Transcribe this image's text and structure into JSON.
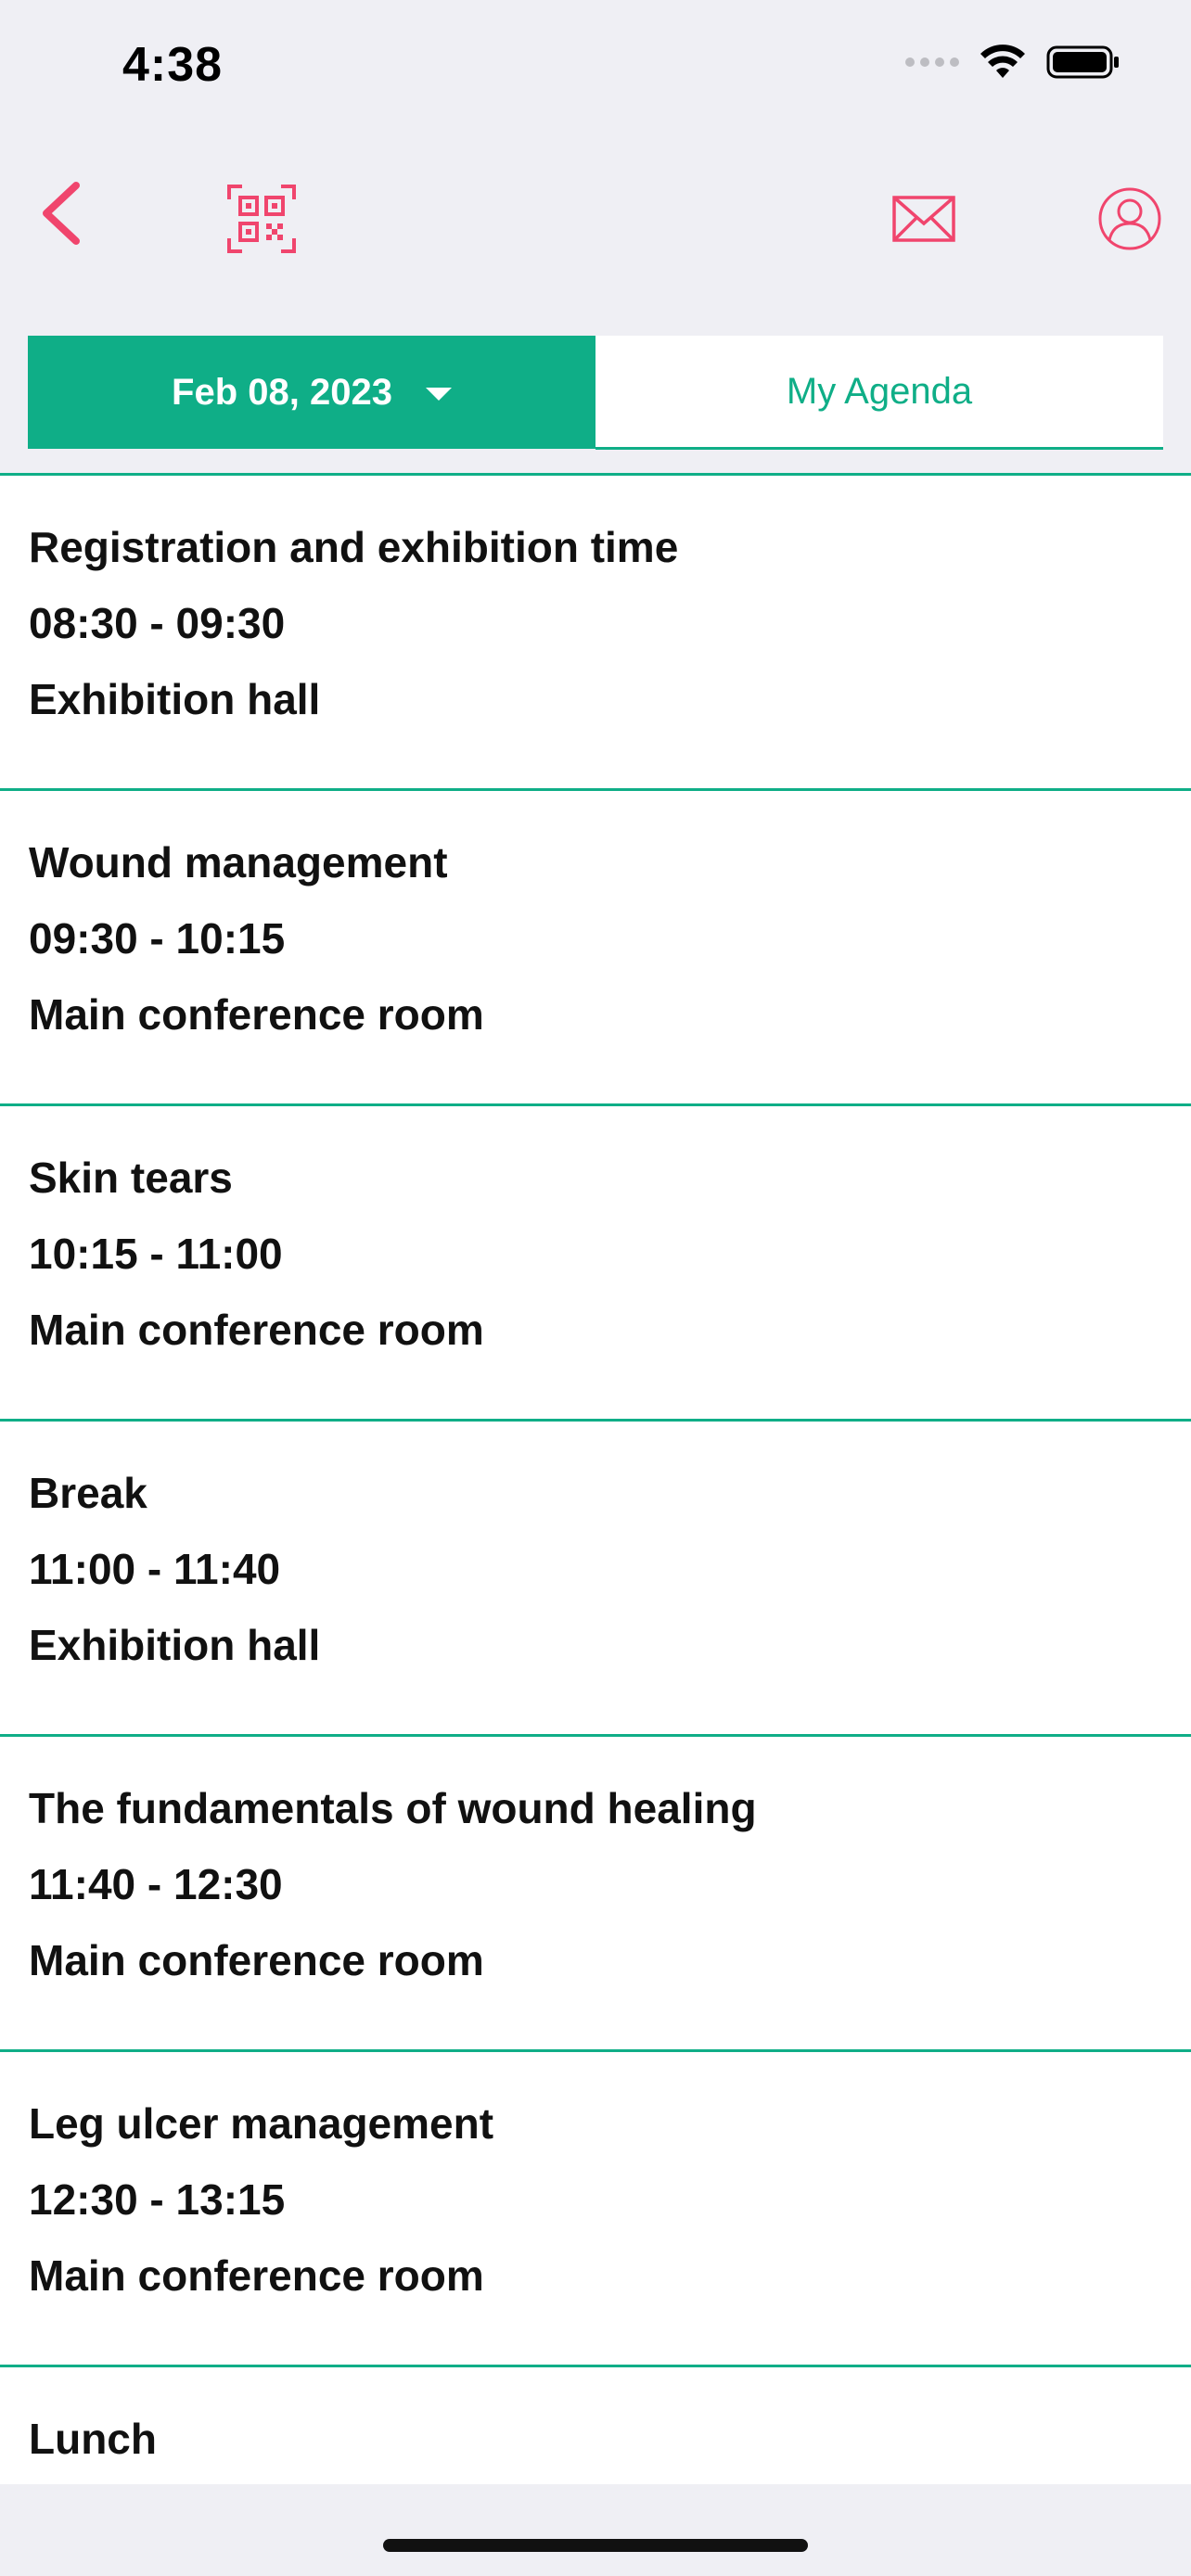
{
  "status_bar": {
    "time": "4:38"
  },
  "nav": {
    "back_icon": "chevron-left-icon",
    "qr_icon": "qr-scan-icon",
    "mail_icon": "envelope-icon",
    "profile_icon": "user-circle-icon",
    "accent_color": "#f0456d"
  },
  "segment": {
    "date_label": "Feb 08, 2023",
    "agenda_label": "My Agenda",
    "active_color": "#0fae87"
  },
  "agenda": [
    {
      "title": "Registration and exhibition time",
      "time": "08:30 - 09:30",
      "location": "Exhibition hall"
    },
    {
      "title": "Wound management",
      "time": "09:30 - 10:15",
      "location": "Main conference room"
    },
    {
      "title": "Skin tears",
      "time": "10:15 - 11:00",
      "location": "Main conference room"
    },
    {
      "title": "Break",
      "time": "11:00 - 11:40",
      "location": "Exhibition hall"
    },
    {
      "title": "The fundamentals of wound healing",
      "time": "11:40 - 12:30",
      "location": "Main conference room"
    },
    {
      "title": "Leg ulcer management",
      "time": "12:30 - 13:15",
      "location": "Main conference room"
    },
    {
      "title": "Lunch",
      "time": "",
      "location": ""
    }
  ]
}
